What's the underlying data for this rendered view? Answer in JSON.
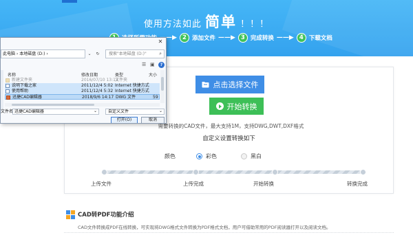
{
  "hero": {
    "title_prefix": "使用方法如此",
    "title_big": "简单",
    "title_suffix": "！！！",
    "steps": [
      {
        "num": "1",
        "label": "选择所需功能"
      },
      {
        "num": "2",
        "label": "添加文件"
      },
      {
        "num": "3",
        "label": "完成转换"
      },
      {
        "num": "4",
        "label": "下载文档"
      }
    ],
    "arrow": "——▶"
  },
  "card": {
    "select_button": "点击选择文件",
    "start_button": "开始转换",
    "hint": "需要转换的CAD文件，最大支持1M，支持DWG,DWT,DXF格式",
    "setting_title": "自定义设置转换如下",
    "color_label": "颜色",
    "color_options": [
      {
        "label": "彩色",
        "selected": true
      },
      {
        "label": "黑白",
        "selected": false
      }
    ],
    "stages": [
      "上传文件",
      "上传完成",
      "开始转换",
      "转换完成"
    ]
  },
  "intro": {
    "title": "CAD转PDF功能介绍",
    "text": "CAD文件转换成PDF在线转换，可实现将DWG格式文件转换为PDF格式文档，用户可借助常用的PDF阅读器打开以及阅读文档。"
  },
  "dialog": {
    "close": "✕",
    "address": "此电脑 › 本地磁盘 (D:) ›",
    "search_placeholder": "搜索\"本地磁盘 (D:)\"",
    "columns": [
      "名称",
      "修改日期",
      "类型",
      "大小"
    ],
    "files": [
      {
        "name": "新建文件夹",
        "date": "2016/07/10 13:13",
        "type": "文件夹",
        "icon": "folder-icon",
        "selected": false
      },
      {
        "name": "说明下载之家",
        "date": "2011/12/4 5:02",
        "type": "Internet 快捷方式",
        "icon": "shortcut-icon",
        "selected": true
      },
      {
        "name": "使用帮助",
        "date": "2011/12/4 5:32",
        "type": "Internet 快捷方式",
        "icon": "shortcut-icon",
        "selected": true
      },
      {
        "name": "迅捷CAD编辑器",
        "date": "2018/9/6 14:17",
        "type": "DWG 文件",
        "size": "59",
        "icon": "dwg-file-icon",
        "selected": true
      }
    ],
    "filename_label": "文件名(N):",
    "filename_value": "迅捷CAD编辑器",
    "filetype_value": "自定义文件",
    "open_button": "打开(O)",
    "cancel_button": "取消"
  },
  "colors": {
    "hero_bg": "#3aa9f2",
    "select_button": "#3f8ee6",
    "start_button": "#3dbf57",
    "step_badge": "#3fc35a"
  }
}
